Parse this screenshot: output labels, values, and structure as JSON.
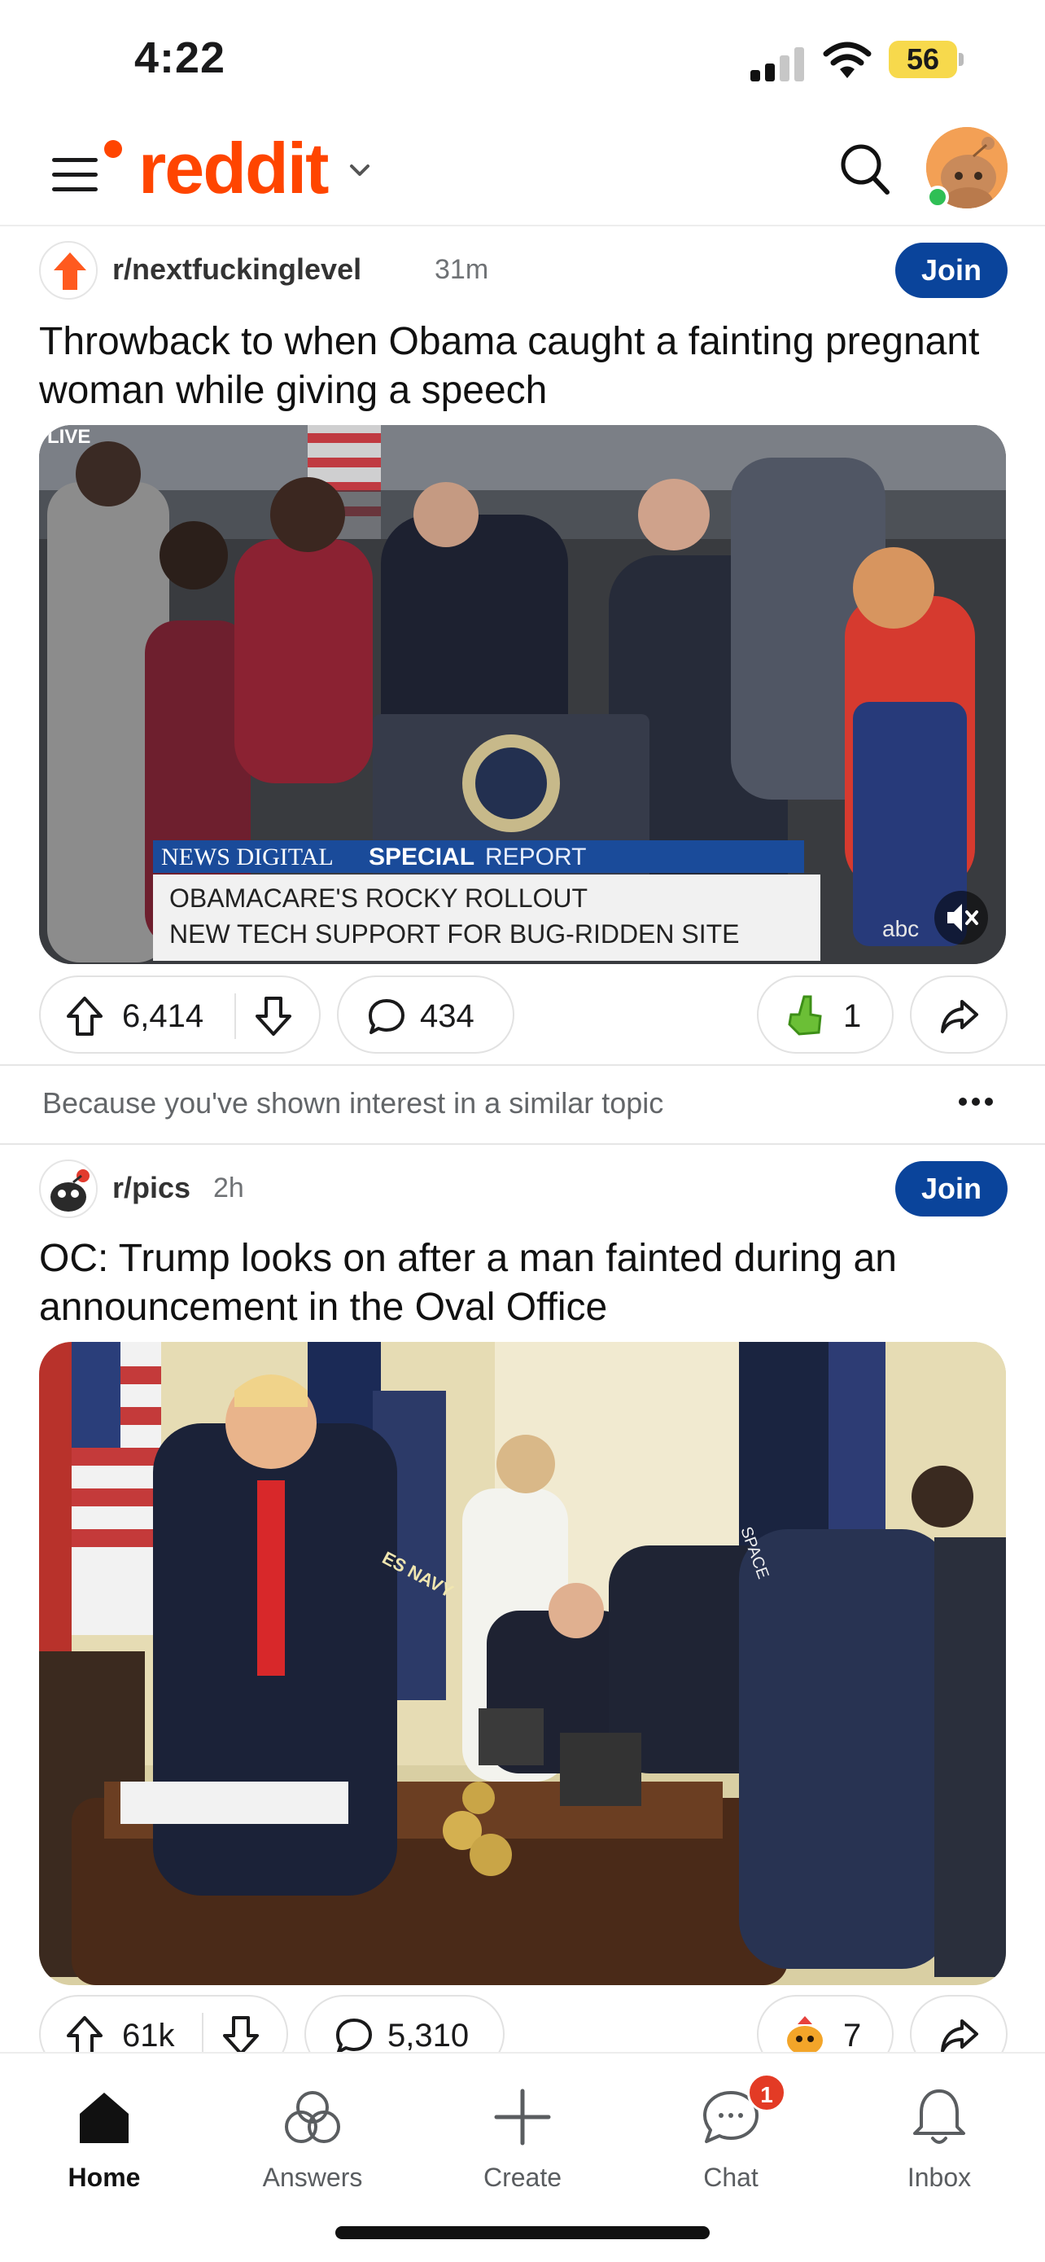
{
  "status": {
    "time": "4:22",
    "battery": "56"
  },
  "header": {
    "logo": "reddit"
  },
  "posts": [
    {
      "subreddit": "r/nextfuckinglevel",
      "age": "31m",
      "join_label": "Join",
      "title": "Throwback to when Obama caught a fainting pregnant woman while giving a speech",
      "media": {
        "kind": "video",
        "live_label": "LIVE",
        "banner_brand": "NEWS DIGITAL",
        "banner_special": "SPECIAL",
        "banner_report": "REPORT",
        "headline_1": "OBAMACARE'S ROCKY ROLLOUT",
        "headline_2": "NEW TECH SUPPORT FOR BUG-RIDDEN SITE",
        "watermark": "abc",
        "muted": true
      },
      "upvotes": "6,414",
      "comments": "434",
      "awards": "1"
    },
    {
      "recommendation": "Because you've shown interest in a similar topic",
      "subreddit": "r/pics",
      "age": "2h",
      "join_label": "Join",
      "title": "OC: Trump looks on after a man fainted during an announcement in the Oval Office",
      "media": {
        "kind": "image",
        "flag_text_1": "ES NAVY",
        "flag_text_2": "SPACE"
      },
      "upvotes": "61k",
      "comments": "5,310",
      "awards": "7"
    }
  ],
  "nav": {
    "items": [
      {
        "label": "Home",
        "icon": "home-icon",
        "active": true
      },
      {
        "label": "Answers",
        "icon": "answers-icon",
        "active": false
      },
      {
        "label": "Create",
        "icon": "plus-icon",
        "active": false
      },
      {
        "label": "Chat",
        "icon": "chat-icon",
        "active": false,
        "badge": "1"
      },
      {
        "label": "Inbox",
        "icon": "bell-icon",
        "active": false
      }
    ]
  },
  "colors": {
    "brand": "#ff4500",
    "join": "#0a449b",
    "badge": "#e33b25",
    "battery": "#f7d94c"
  }
}
